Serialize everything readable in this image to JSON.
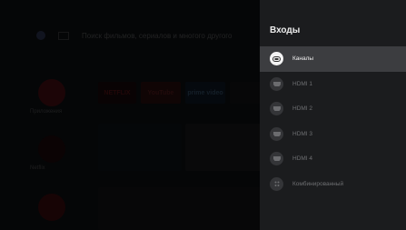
{
  "background": {
    "search_text": "Поиск фильмов, сериалов и многого другого",
    "apps_label": "Приложения",
    "netflix_label": "Netflix",
    "tiles": [
      "NETFLIX",
      "YouTube",
      "prime video"
    ]
  },
  "panel": {
    "title": "Входы",
    "items": [
      {
        "label": "Каналы",
        "icon": "tv-antenna-icon",
        "selected": true
      },
      {
        "label": "HDMI 1",
        "icon": "hdmi-icon",
        "selected": false
      },
      {
        "label": "HDMI 2",
        "icon": "hdmi-icon",
        "selected": false
      },
      {
        "label": "HDMI 3",
        "icon": "hdmi-icon",
        "selected": false
      },
      {
        "label": "HDMI 4",
        "icon": "hdmi-icon",
        "selected": false
      },
      {
        "label": "Комбинированный",
        "icon": "composite-icon",
        "selected": false
      }
    ]
  },
  "colors": {
    "panel_bg": "#1b1c1e",
    "selected_bg": "#3c3d40"
  }
}
